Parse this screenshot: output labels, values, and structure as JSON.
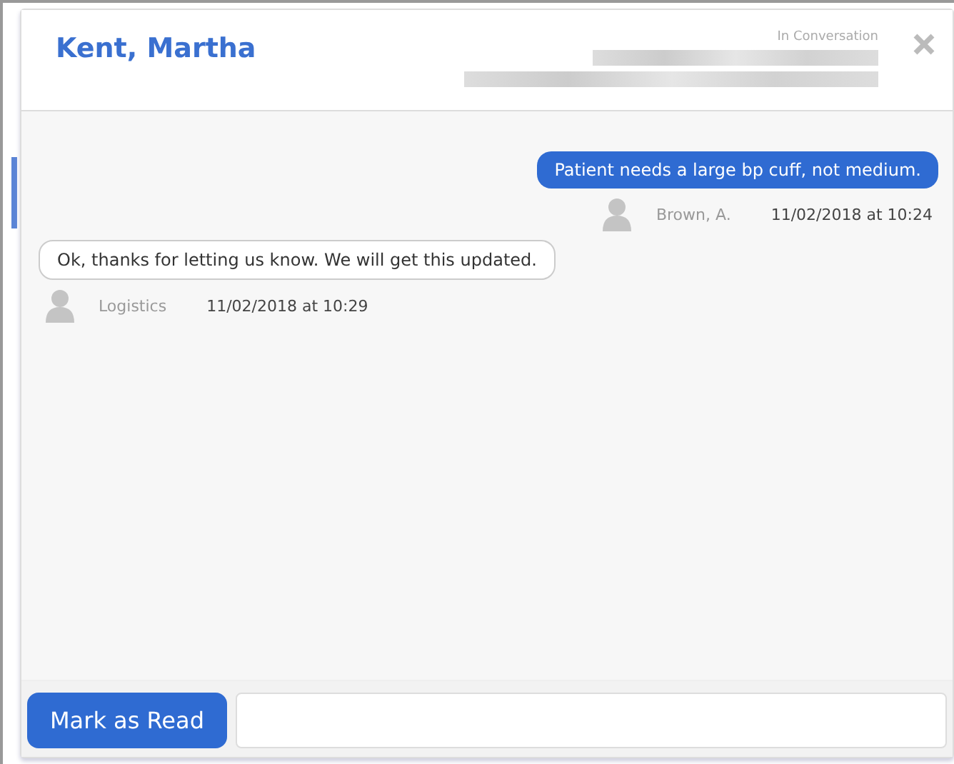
{
  "header": {
    "title": "Kent, Martha",
    "status": "In Conversation"
  },
  "messages": [
    {
      "kind": "outgoing",
      "text": "Patient needs a large bp cuff, not medium.",
      "sender": "Brown, A.",
      "time": "11/02/2018 at 10:24"
    },
    {
      "kind": "incoming",
      "text": "Ok, thanks for letting us know. We will get this updated.",
      "sender": "Logistics",
      "time": "11/02/2018 at 10:29"
    }
  ],
  "footer": {
    "button": "Mark as Read"
  }
}
